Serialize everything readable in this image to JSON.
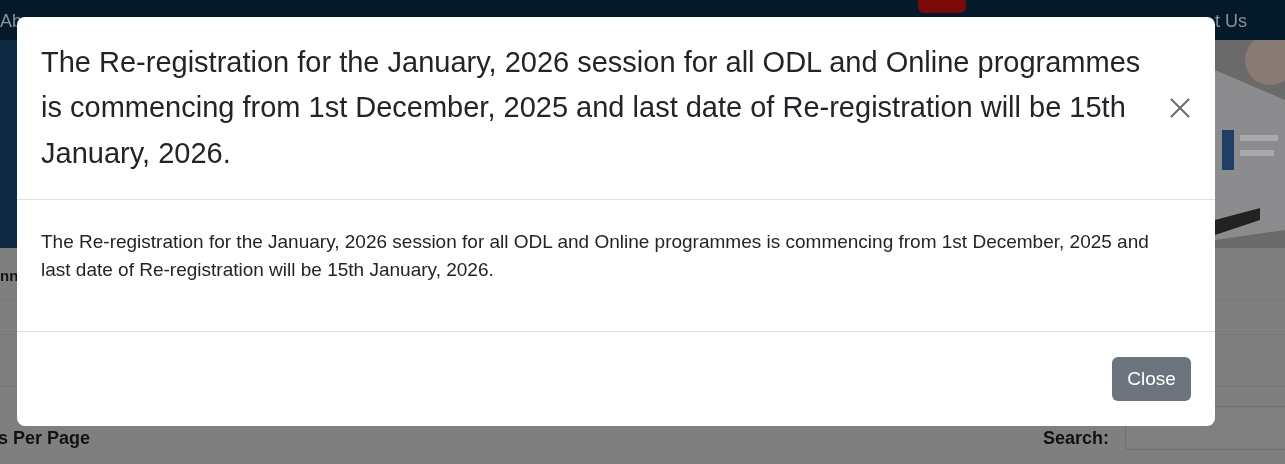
{
  "navbar": {
    "left_item": "Ab",
    "right_item": "t Us"
  },
  "page": {
    "section_heading": "nn",
    "per_page_label": "s Per Page",
    "search_label": "Search:"
  },
  "modal": {
    "title": "The Re-registration for the January, 2026 session for all ODL and Online programmes is commencing from 1st December, 2025 and last date of Re-registration will be 15th January, 2026.",
    "body": "The Re-registration for the January, 2026 session for all ODL and Online programmes is commencing from 1st December, 2025 and last date of Re-registration will be 15th January, 2026.",
    "close_button": "Close"
  }
}
